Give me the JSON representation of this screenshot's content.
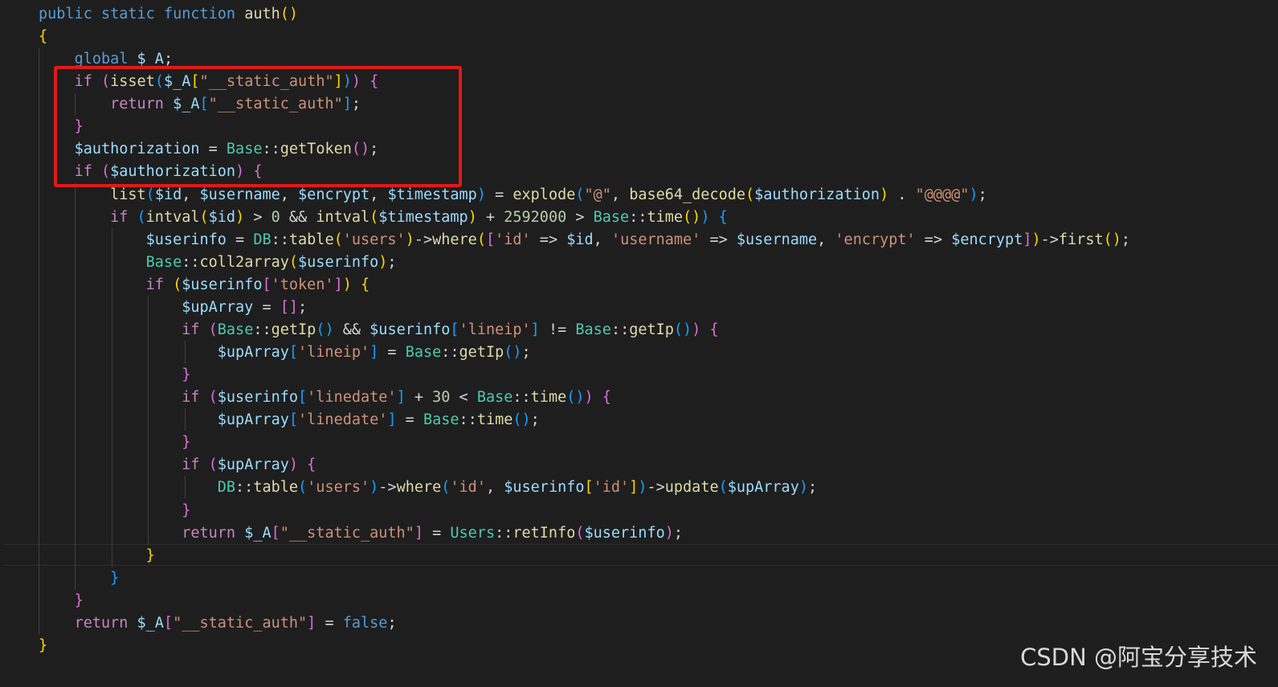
{
  "editor": {
    "language": "PHP",
    "highlight_color": "#e01919",
    "lines": [
      [
        {
          "t": "public ",
          "c": "kw"
        },
        {
          "t": "static ",
          "c": "kw"
        },
        {
          "t": "function ",
          "c": "kw"
        },
        {
          "t": "auth",
          "c": "fn"
        },
        {
          "t": "()",
          "c": "br1"
        }
      ],
      [
        {
          "t": "{",
          "c": "br1"
        }
      ],
      [
        {
          "t": "    "
        },
        {
          "t": "global ",
          "c": "kw"
        },
        {
          "t": "$_A",
          "c": "var"
        },
        {
          "t": ";"
        }
      ],
      [
        {
          "t": "    "
        },
        {
          "t": "if ",
          "c": "ctl"
        },
        {
          "t": "(",
          "c": "br2"
        },
        {
          "t": "isset",
          "c": "fn"
        },
        {
          "t": "(",
          "c": "br3"
        },
        {
          "t": "$_A",
          "c": "var"
        },
        {
          "t": "[",
          "c": "br1"
        },
        {
          "t": "\"__static_auth\"",
          "c": "str"
        },
        {
          "t": "]",
          "c": "br1"
        },
        {
          "t": ")",
          "c": "br3"
        },
        {
          "t": ")",
          "c": "br2"
        },
        {
          "t": " "
        },
        {
          "t": "{",
          "c": "br2"
        }
      ],
      [
        {
          "t": "        "
        },
        {
          "t": "return ",
          "c": "ctl"
        },
        {
          "t": "$_A",
          "c": "var"
        },
        {
          "t": "[",
          "c": "br3"
        },
        {
          "t": "\"__static_auth\"",
          "c": "str"
        },
        {
          "t": "]",
          "c": "br3"
        },
        {
          "t": ";"
        }
      ],
      [
        {
          "t": "    "
        },
        {
          "t": "}",
          "c": "br2"
        }
      ],
      [
        {
          "t": "    "
        },
        {
          "t": "$authorization",
          "c": "var"
        },
        {
          "t": " = "
        },
        {
          "t": "Base",
          "c": "cls"
        },
        {
          "t": "::"
        },
        {
          "t": "getToken",
          "c": "fn"
        },
        {
          "t": "()",
          "c": "br2"
        },
        {
          "t": ";"
        }
      ],
      [
        {
          "t": "    "
        },
        {
          "t": "if ",
          "c": "ctl"
        },
        {
          "t": "(",
          "c": "br2"
        },
        {
          "t": "$authorization",
          "c": "var"
        },
        {
          "t": ")",
          "c": "br2"
        },
        {
          "t": " "
        },
        {
          "t": "{",
          "c": "br2"
        }
      ],
      [
        {
          "t": "        "
        },
        {
          "t": "list",
          "c": "fn"
        },
        {
          "t": "(",
          "c": "br3"
        },
        {
          "t": "$id",
          "c": "var"
        },
        {
          "t": ", "
        },
        {
          "t": "$username",
          "c": "var"
        },
        {
          "t": ", "
        },
        {
          "t": "$encrypt",
          "c": "var"
        },
        {
          "t": ", "
        },
        {
          "t": "$timestamp",
          "c": "var"
        },
        {
          "t": ")",
          "c": "br3"
        },
        {
          "t": " = "
        },
        {
          "t": "explode",
          "c": "fn"
        },
        {
          "t": "(",
          "c": "br3"
        },
        {
          "t": "\"@\"",
          "c": "str"
        },
        {
          "t": ", "
        },
        {
          "t": "base64_decode",
          "c": "fn"
        },
        {
          "t": "(",
          "c": "br1"
        },
        {
          "t": "$authorization",
          "c": "var"
        },
        {
          "t": ")",
          "c": "br1"
        },
        {
          "t": " . "
        },
        {
          "t": "\"@@@@\"",
          "c": "str"
        },
        {
          "t": ")",
          "c": "br3"
        },
        {
          "t": ";"
        }
      ],
      [
        {
          "t": "        "
        },
        {
          "t": "if ",
          "c": "ctl"
        },
        {
          "t": "(",
          "c": "br3"
        },
        {
          "t": "intval",
          "c": "fn"
        },
        {
          "t": "(",
          "c": "br1"
        },
        {
          "t": "$id",
          "c": "var"
        },
        {
          "t": ")",
          "c": "br1"
        },
        {
          "t": " > "
        },
        {
          "t": "0",
          "c": "num"
        },
        {
          "t": " && "
        },
        {
          "t": "intval",
          "c": "fn"
        },
        {
          "t": "(",
          "c": "br1"
        },
        {
          "t": "$timestamp",
          "c": "var"
        },
        {
          "t": ")",
          "c": "br1"
        },
        {
          "t": " + "
        },
        {
          "t": "2592000",
          "c": "num"
        },
        {
          "t": " > "
        },
        {
          "t": "Base",
          "c": "cls"
        },
        {
          "t": "::"
        },
        {
          "t": "time",
          "c": "fn"
        },
        {
          "t": "()",
          "c": "br1"
        },
        {
          "t": ")",
          "c": "br3"
        },
        {
          "t": " "
        },
        {
          "t": "{",
          "c": "br3"
        }
      ],
      [
        {
          "t": "            "
        },
        {
          "t": "$userinfo",
          "c": "var"
        },
        {
          "t": " = "
        },
        {
          "t": "DB",
          "c": "cls"
        },
        {
          "t": "::"
        },
        {
          "t": "table",
          "c": "fn"
        },
        {
          "t": "(",
          "c": "br1"
        },
        {
          "t": "'users'",
          "c": "str"
        },
        {
          "t": ")",
          "c": "br1"
        },
        {
          "t": "->"
        },
        {
          "t": "where",
          "c": "fn"
        },
        {
          "t": "(",
          "c": "br1"
        },
        {
          "t": "[",
          "c": "br2"
        },
        {
          "t": "'id'",
          "c": "str"
        },
        {
          "t": " => "
        },
        {
          "t": "$id",
          "c": "var"
        },
        {
          "t": ", "
        },
        {
          "t": "'username'",
          "c": "str"
        },
        {
          "t": " => "
        },
        {
          "t": "$username",
          "c": "var"
        },
        {
          "t": ", "
        },
        {
          "t": "'encrypt'",
          "c": "str"
        },
        {
          "t": " => "
        },
        {
          "t": "$encrypt",
          "c": "var"
        },
        {
          "t": "]",
          "c": "br2"
        },
        {
          "t": ")",
          "c": "br1"
        },
        {
          "t": "->"
        },
        {
          "t": "first",
          "c": "fn"
        },
        {
          "t": "()",
          "c": "br1"
        },
        {
          "t": ";"
        }
      ],
      [
        {
          "t": "            "
        },
        {
          "t": "Base",
          "c": "cls"
        },
        {
          "t": "::"
        },
        {
          "t": "coll2array",
          "c": "fn"
        },
        {
          "t": "(",
          "c": "br1"
        },
        {
          "t": "$userinfo",
          "c": "var"
        },
        {
          "t": ")",
          "c": "br1"
        },
        {
          "t": ";"
        }
      ],
      [
        {
          "t": "            "
        },
        {
          "t": "if ",
          "c": "ctl"
        },
        {
          "t": "(",
          "c": "br1"
        },
        {
          "t": "$userinfo",
          "c": "var"
        },
        {
          "t": "[",
          "c": "br2"
        },
        {
          "t": "'token'",
          "c": "str"
        },
        {
          "t": "]",
          "c": "br2"
        },
        {
          "t": ")",
          "c": "br1"
        },
        {
          "t": " "
        },
        {
          "t": "{",
          "c": "br1"
        }
      ],
      [
        {
          "t": "                "
        },
        {
          "t": "$upArray",
          "c": "var"
        },
        {
          "t": " = "
        },
        {
          "t": "[]",
          "c": "br2"
        },
        {
          "t": ";"
        }
      ],
      [
        {
          "t": "                "
        },
        {
          "t": "if ",
          "c": "ctl"
        },
        {
          "t": "(",
          "c": "br2"
        },
        {
          "t": "Base",
          "c": "cls"
        },
        {
          "t": "::"
        },
        {
          "t": "getIp",
          "c": "fn"
        },
        {
          "t": "()",
          "c": "br3"
        },
        {
          "t": " && "
        },
        {
          "t": "$userinfo",
          "c": "var"
        },
        {
          "t": "[",
          "c": "br3"
        },
        {
          "t": "'lineip'",
          "c": "str"
        },
        {
          "t": "]",
          "c": "br3"
        },
        {
          "t": " != "
        },
        {
          "t": "Base",
          "c": "cls"
        },
        {
          "t": "::"
        },
        {
          "t": "getIp",
          "c": "fn"
        },
        {
          "t": "()",
          "c": "br3"
        },
        {
          "t": ")",
          "c": "br2"
        },
        {
          "t": " "
        },
        {
          "t": "{",
          "c": "br2"
        }
      ],
      [
        {
          "t": "                    "
        },
        {
          "t": "$upArray",
          "c": "var"
        },
        {
          "t": "[",
          "c": "br3"
        },
        {
          "t": "'lineip'",
          "c": "str"
        },
        {
          "t": "]",
          "c": "br3"
        },
        {
          "t": " = "
        },
        {
          "t": "Base",
          "c": "cls"
        },
        {
          "t": "::"
        },
        {
          "t": "getIp",
          "c": "fn"
        },
        {
          "t": "()",
          "c": "br3"
        },
        {
          "t": ";"
        }
      ],
      [
        {
          "t": "                "
        },
        {
          "t": "}",
          "c": "br2"
        }
      ],
      [
        {
          "t": "                "
        },
        {
          "t": "if ",
          "c": "ctl"
        },
        {
          "t": "(",
          "c": "br2"
        },
        {
          "t": "$userinfo",
          "c": "var"
        },
        {
          "t": "[",
          "c": "br3"
        },
        {
          "t": "'linedate'",
          "c": "str"
        },
        {
          "t": "]",
          "c": "br3"
        },
        {
          "t": " + "
        },
        {
          "t": "30",
          "c": "num"
        },
        {
          "t": " < "
        },
        {
          "t": "Base",
          "c": "cls"
        },
        {
          "t": "::"
        },
        {
          "t": "time",
          "c": "fn"
        },
        {
          "t": "()",
          "c": "br3"
        },
        {
          "t": ")",
          "c": "br2"
        },
        {
          "t": " "
        },
        {
          "t": "{",
          "c": "br2"
        }
      ],
      [
        {
          "t": "                    "
        },
        {
          "t": "$upArray",
          "c": "var"
        },
        {
          "t": "[",
          "c": "br3"
        },
        {
          "t": "'linedate'",
          "c": "str"
        },
        {
          "t": "]",
          "c": "br3"
        },
        {
          "t": " = "
        },
        {
          "t": "Base",
          "c": "cls"
        },
        {
          "t": "::"
        },
        {
          "t": "time",
          "c": "fn"
        },
        {
          "t": "()",
          "c": "br3"
        },
        {
          "t": ";"
        }
      ],
      [
        {
          "t": "                "
        },
        {
          "t": "}",
          "c": "br2"
        }
      ],
      [
        {
          "t": "                "
        },
        {
          "t": "if ",
          "c": "ctl"
        },
        {
          "t": "(",
          "c": "br2"
        },
        {
          "t": "$upArray",
          "c": "var"
        },
        {
          "t": ")",
          "c": "br2"
        },
        {
          "t": " "
        },
        {
          "t": "{",
          "c": "br2"
        }
      ],
      [
        {
          "t": "                    "
        },
        {
          "t": "DB",
          "c": "cls"
        },
        {
          "t": "::"
        },
        {
          "t": "table",
          "c": "fn"
        },
        {
          "t": "(",
          "c": "br3"
        },
        {
          "t": "'users'",
          "c": "str"
        },
        {
          "t": ")",
          "c": "br3"
        },
        {
          "t": "->"
        },
        {
          "t": "where",
          "c": "fn"
        },
        {
          "t": "(",
          "c": "br3"
        },
        {
          "t": "'id'",
          "c": "str"
        },
        {
          "t": ", "
        },
        {
          "t": "$userinfo",
          "c": "var"
        },
        {
          "t": "[",
          "c": "br1"
        },
        {
          "t": "'id'",
          "c": "str"
        },
        {
          "t": "]",
          "c": "br1"
        },
        {
          "t": ")",
          "c": "br3"
        },
        {
          "t": "->"
        },
        {
          "t": "update",
          "c": "fn"
        },
        {
          "t": "(",
          "c": "br3"
        },
        {
          "t": "$upArray",
          "c": "var"
        },
        {
          "t": ")",
          "c": "br3"
        },
        {
          "t": ";"
        }
      ],
      [
        {
          "t": "                "
        },
        {
          "t": "}",
          "c": "br2"
        }
      ],
      [
        {
          "t": "                "
        },
        {
          "t": "return ",
          "c": "ctl"
        },
        {
          "t": "$_A",
          "c": "var"
        },
        {
          "t": "[",
          "c": "br2"
        },
        {
          "t": "\"__static_auth\"",
          "c": "str"
        },
        {
          "t": "]",
          "c": "br2"
        },
        {
          "t": " = "
        },
        {
          "t": "Users",
          "c": "cls"
        },
        {
          "t": "::"
        },
        {
          "t": "retInfo",
          "c": "fn"
        },
        {
          "t": "(",
          "c": "br2"
        },
        {
          "t": "$userinfo",
          "c": "var"
        },
        {
          "t": ")",
          "c": "br2"
        },
        {
          "t": ";"
        }
      ],
      [
        {
          "t": "            "
        },
        {
          "t": "}",
          "c": "br1"
        }
      ],
      [
        {
          "t": "        "
        },
        {
          "t": "}",
          "c": "br3"
        }
      ],
      [
        {
          "t": "    "
        },
        {
          "t": "}",
          "c": "br2"
        }
      ],
      [
        {
          "t": "    "
        },
        {
          "t": "return ",
          "c": "ctl"
        },
        {
          "t": "$_A",
          "c": "var"
        },
        {
          "t": "[",
          "c": "br2"
        },
        {
          "t": "\"__static_auth\"",
          "c": "str"
        },
        {
          "t": "]",
          "c": "br2"
        },
        {
          "t": " = "
        },
        {
          "t": "false",
          "c": "kw"
        },
        {
          "t": ";"
        }
      ],
      [
        {
          "t": "}",
          "c": "br1"
        }
      ]
    ]
  },
  "watermark": "CSDN @阿宝分享技术"
}
